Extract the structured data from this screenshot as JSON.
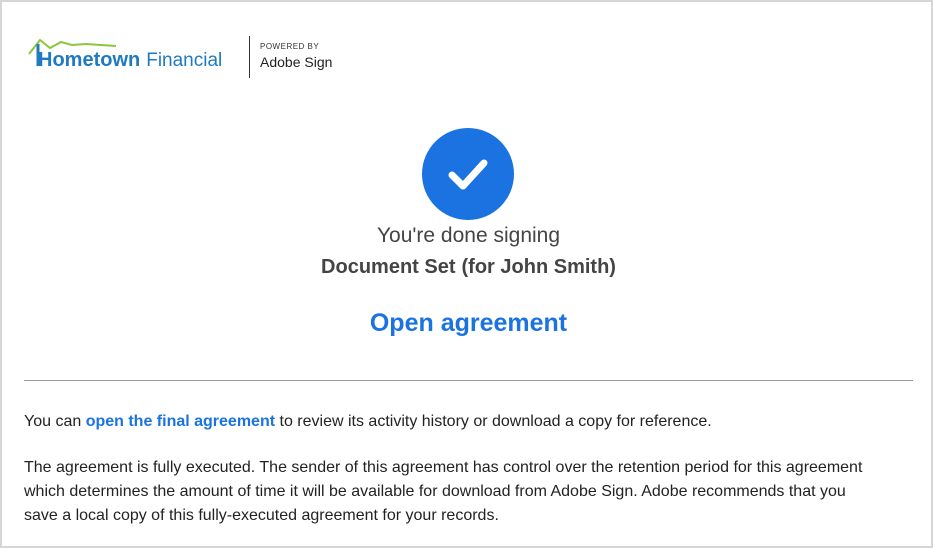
{
  "header": {
    "logo_bold": "Hometown",
    "logo_light": "Financial",
    "powered_by": "POWERED BY",
    "adobe_sign": "Adobe Sign"
  },
  "status": {
    "done_text": "You're done signing",
    "document_name": "Document Set",
    "for_text": "(for John Smith)"
  },
  "open_agreement_label": "Open agreement",
  "info": {
    "p1_prefix": "You can ",
    "p1_link": "open the final agreement",
    "p1_suffix": " to review its activity history or download a copy for reference.",
    "p2": "The agreement is fully executed. The sender of this agreement has control over the retention period for this agreement which determines the amount of time it will be available for download from Adobe Sign. Adobe recommends that you save a local copy of this fully-executed agreement for your records."
  },
  "colors": {
    "accent_blue": "#1a73e0",
    "logo_blue": "#1f7ac0",
    "logo_green": "#8cc63f"
  },
  "icons": {
    "logo": "house-roof-logo",
    "check": "checkmark-circle-icon"
  }
}
